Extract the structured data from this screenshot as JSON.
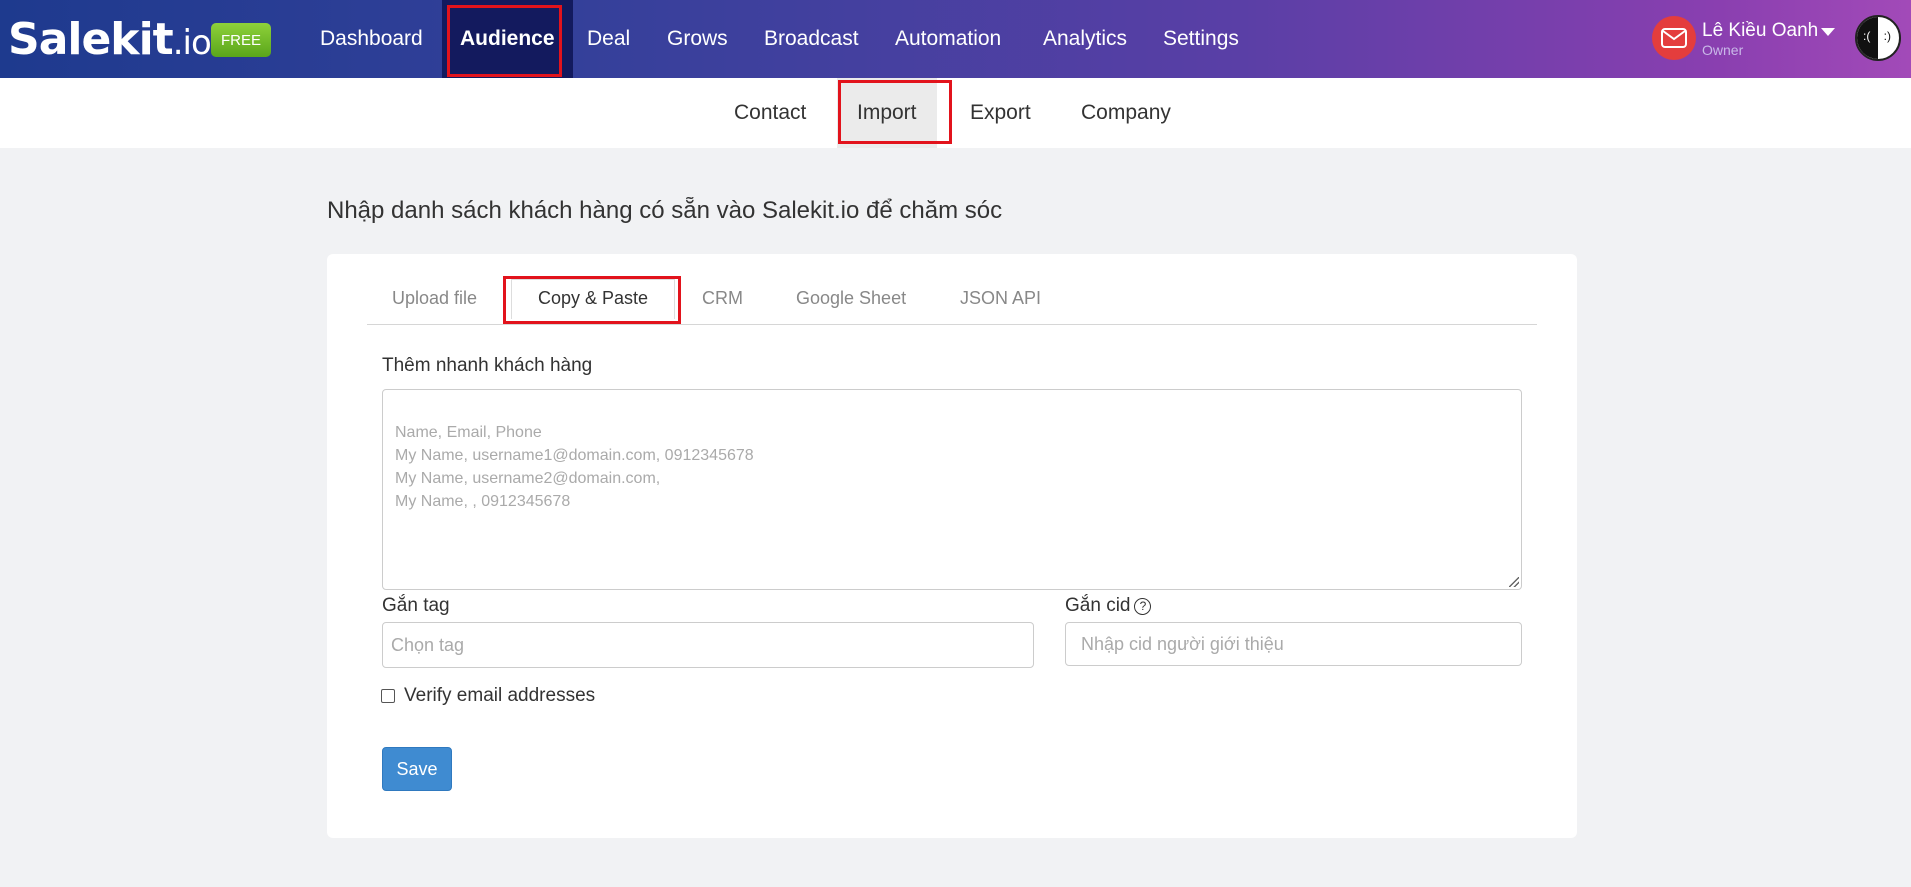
{
  "brand": {
    "logo_main": "Salekit",
    "logo_suffix": ".io",
    "plan_badge": "FREE"
  },
  "nav": {
    "items": [
      {
        "label": "Dashboard"
      },
      {
        "label": "Audience",
        "active": true
      },
      {
        "label": "Deal"
      },
      {
        "label": "Grows"
      },
      {
        "label": "Broadcast"
      },
      {
        "label": "Automation"
      },
      {
        "label": "Analytics"
      },
      {
        "label": "Settings"
      }
    ]
  },
  "user": {
    "name": "Lê Kiều Oanh",
    "role": "Owner",
    "avatar_left": ":(",
    "avatar_right": ":)"
  },
  "subnav": {
    "items": [
      {
        "label": "Contact"
      },
      {
        "label": "Import",
        "active": true
      },
      {
        "label": "Export"
      },
      {
        "label": "Company"
      }
    ]
  },
  "page": {
    "title": "Nhập danh sách khách hàng có sẵn vào Salekit.io để chăm sóc"
  },
  "tabs": [
    {
      "label": "Upload file"
    },
    {
      "label": "Copy & Paste",
      "active": true
    },
    {
      "label": "CRM"
    },
    {
      "label": "Google Sheet"
    },
    {
      "label": "JSON API"
    }
  ],
  "form": {
    "quick_add_label": "Thêm nhanh khách hàng",
    "quick_add_placeholder": "Name, Email, Phone\nMy Name, username1@domain.com, 0912345678\nMy Name, username2@domain.com,\nMy Name,  , 0912345678",
    "tag_label": "Gắn tag",
    "tag_placeholder": "Chọn tag",
    "cid_label": "Gắn cid",
    "cid_help": "?",
    "cid_placeholder": "Nhập cid người giới thiệu",
    "verify_label": "Verify email addresses",
    "verify_checked": false,
    "save_label": "Save"
  },
  "colors": {
    "highlight": "#e2131c",
    "save_button": "#3f8bd1",
    "free_badge": "#7cc22a"
  }
}
